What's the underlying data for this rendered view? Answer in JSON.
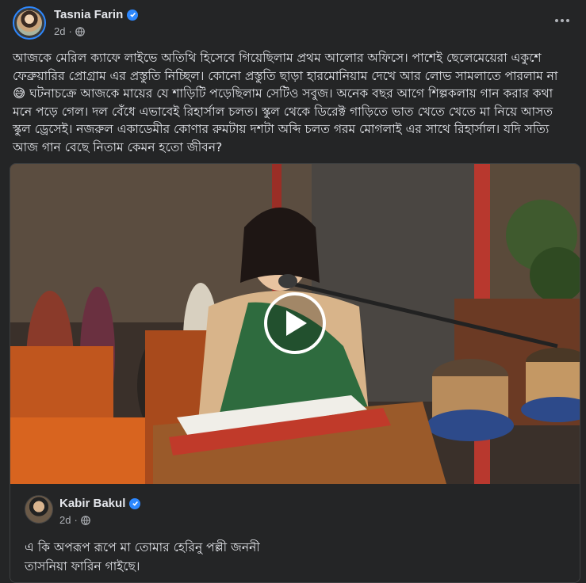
{
  "post": {
    "author": "Tasnia Farin",
    "time": "2d",
    "text": "আজকে মেরিল ক্যাফে লাইভে অতিথি হিসেবে গিয়েছিলাম প্রথম আলোর অফিসে। পাশেই ছেলেমেয়েরা একুশে ফেব্রুয়ারির প্রোগ্রাম এর প্রস্তুতি নিচ্ছিল। কোনো প্রস্তুতি ছাড়া হারমোনিয়াম দেখে আর লোভ সামলাতে পারলাম না 😅 ঘটনাচক্রে আজকে মায়ের যে শাড়িটি পড়েছিলাম সেটিও সবুজ। অনেক বছর আগে শিল্পকলায় গান করার কথা মনে পড়ে গেল। দল বেঁধে এভাবেই রিহার্সাল চলত। স্কুল থেকে ডিরেক্ট গাড়িতে ভাত খেতে খেতে মা নিয়ে আসত স্কুল ড্রেসেই। নজরুল একাডেমীর কোণার রুমটায় দশটা অব্দি চলত গরম মোগলাই এর সাথে রিহার্সাল। যদি সত্যি আজ গান বেছে নিতাম কেমন হতো জীবন?"
  },
  "comment": {
    "author": "Kabir Bakul",
    "time": "2d",
    "lines": [
      "এ কি অপরূপ রূপে মা তোমার হেরিনু পল্লী জননী",
      "তাসনিয়া ফারিন গাইছে।"
    ]
  },
  "colors": {
    "background": "#242526",
    "text": "#e4e6eb",
    "secondary": "#b0b3b8",
    "verified": "#2d88ff"
  },
  "icons": {
    "verified": "verified-badge-icon",
    "audience": "globe-icon",
    "more": "more-options-icon",
    "play": "play-icon"
  }
}
